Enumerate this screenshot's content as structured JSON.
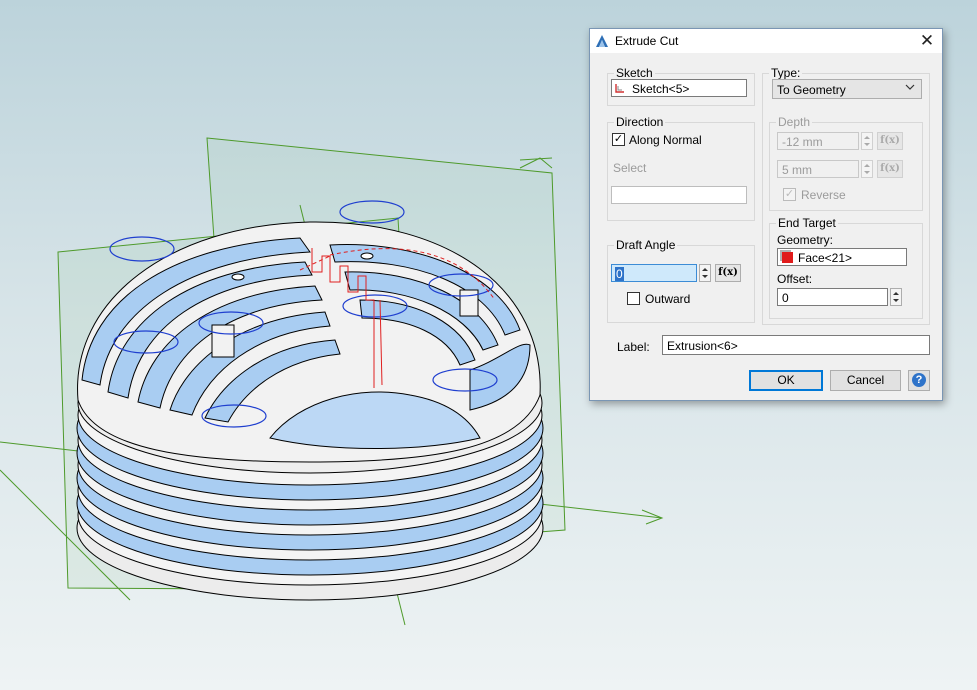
{
  "dialog": {
    "title": "Extrude Cut",
    "close_glyph": "✕",
    "sketch": {
      "group_title": "Sketch",
      "value": "Sketch<5>"
    },
    "direction": {
      "group_title": "Direction",
      "along_normal_label": "Along Normal",
      "along_normal_checked": true,
      "select_label": "Select",
      "select_value": ""
    },
    "draft_angle": {
      "group_title": "Draft Angle",
      "value": "0",
      "outward_label": "Outward",
      "outward_checked": false
    },
    "type": {
      "group_title": "Type:",
      "selected": "To Geometry"
    },
    "depth": {
      "group_title": "Depth",
      "value1": "-12 mm",
      "value2": "5 mm",
      "reverse_label": "Reverse",
      "reverse_checked": true
    },
    "end_target": {
      "group_title": "End Target",
      "geometry_label": "Geometry:",
      "geometry_value": "Face<21>",
      "offset_label": "Offset:",
      "offset_value": "0"
    },
    "label": {
      "label": "Label:",
      "value": "Extrusion<6>"
    },
    "buttons": {
      "ok": "OK",
      "cancel": "Cancel",
      "help_glyph": "?"
    },
    "fx_glyph": "f(x)",
    "check_glyph": "✓"
  },
  "colors": {
    "part_fill": "#a9cdf2",
    "part_edge": "#000000",
    "plane_edge": "#4e9a2b",
    "sketch_circle": "#1f3fcf",
    "sketch_line": "#e02020",
    "accent": "#0078d7"
  },
  "icons": {
    "app": "extrude-app-icon",
    "sketch": "sketch-icon",
    "face": "face-icon",
    "help": "help-icon"
  }
}
